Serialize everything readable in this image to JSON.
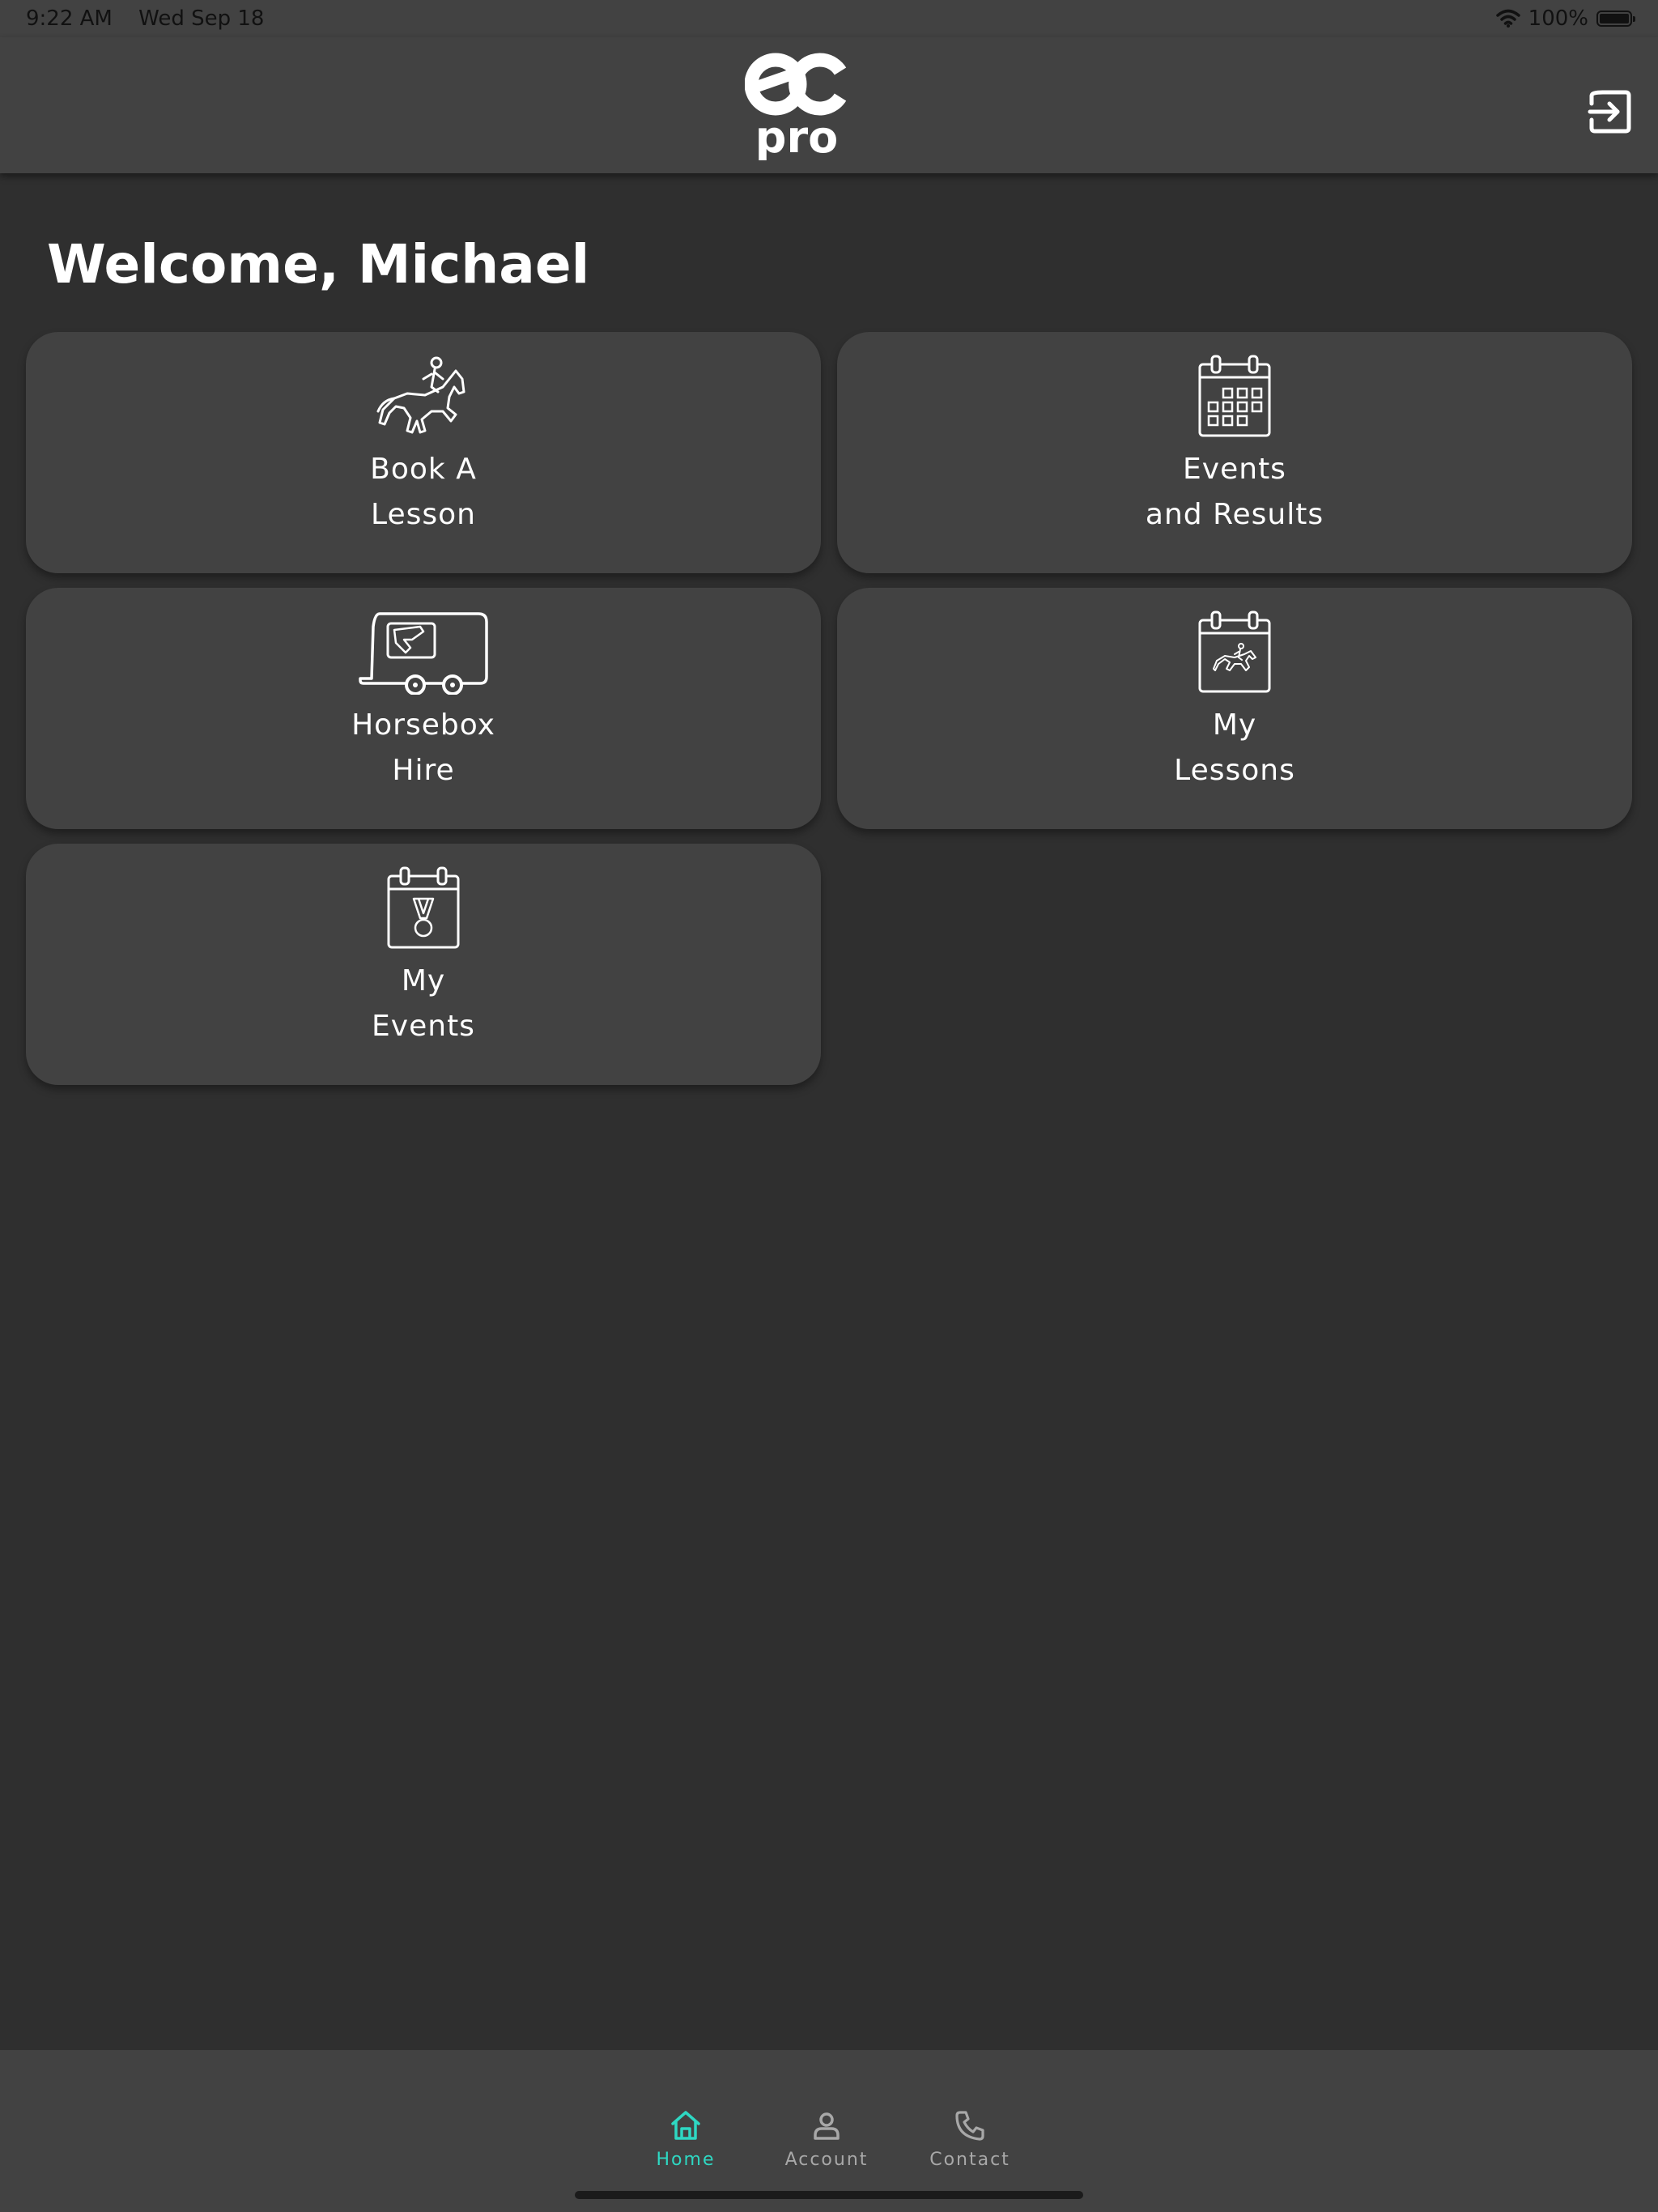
{
  "status_bar": {
    "time": "9:22 AM",
    "date": "Wed Sep 18",
    "battery": "100%"
  },
  "header": {
    "logo_icon": "ec-pro-logo",
    "logo_text_top": "ec",
    "logo_text_bottom": "pro",
    "logout_icon": "logout-icon"
  },
  "welcome": {
    "text": "Welcome, Michael"
  },
  "tiles": [
    {
      "icon": "horse-rider-icon",
      "line1": "Book A",
      "line2": "Lesson"
    },
    {
      "icon": "calendar-icon",
      "line1": "Events",
      "line2": "and Results"
    },
    {
      "icon": "horsebox-icon",
      "line1": "Horsebox",
      "line2": "Hire"
    },
    {
      "icon": "calendar-horse-icon",
      "line1": "My",
      "line2": "Lessons"
    },
    {
      "icon": "calendar-medal-icon",
      "line1": "My",
      "line2": "Events"
    }
  ],
  "bottom_nav": {
    "items": [
      {
        "label": "Home",
        "icon": "home-icon",
        "active": true
      },
      {
        "label": "Account",
        "icon": "user-icon",
        "active": false
      },
      {
        "label": "Contact",
        "icon": "phone-icon",
        "active": false
      }
    ],
    "active_color": "#2ed8c3",
    "inactive_color": "#a8a8a8"
  },
  "colors": {
    "background": "#2f2f2f",
    "surface": "#424242",
    "text": "#ffffff"
  }
}
